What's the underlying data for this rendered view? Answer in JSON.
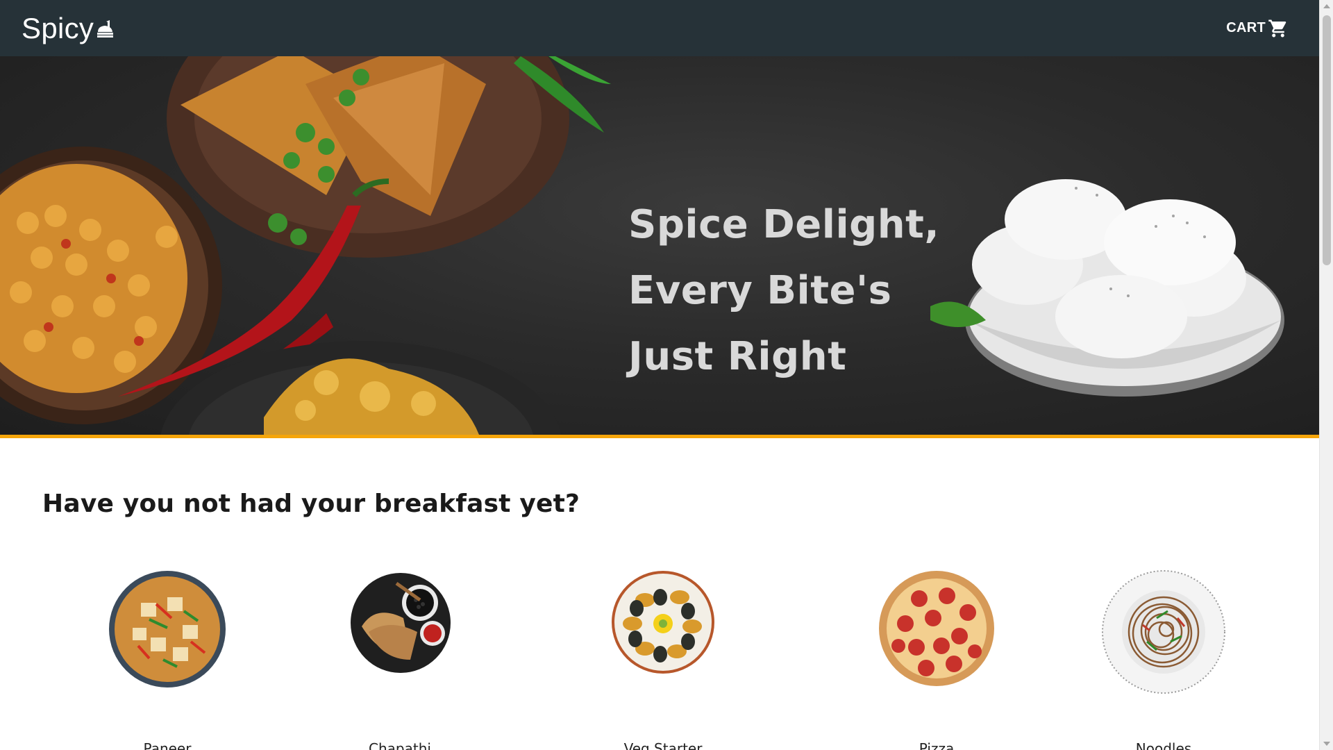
{
  "navbar": {
    "brand": "Spicy",
    "brand_icon": "chef-hat-icon",
    "cart_label": "CART",
    "cart_icon": "shopping-cart-icon",
    "background": "#263238"
  },
  "hero": {
    "headline_lines": [
      "Spice Delight,",
      "Every Bite's",
      "Just Right"
    ],
    "accent_border": "#f5a50a"
  },
  "breakfast": {
    "heading": "Have you not had your breakfast yet?",
    "dishes": [
      {
        "label": "Paneer",
        "icon": "paneer-curry-bowl-icon"
      },
      {
        "label": "Chapathi",
        "icon": "chapathi-plate-icon"
      },
      {
        "label": "Veg Starter",
        "icon": "starter-plate-icon"
      },
      {
        "label": "Pizza",
        "icon": "pizza-icon"
      },
      {
        "label": "Noodles",
        "icon": "noodles-plate-icon"
      }
    ]
  }
}
